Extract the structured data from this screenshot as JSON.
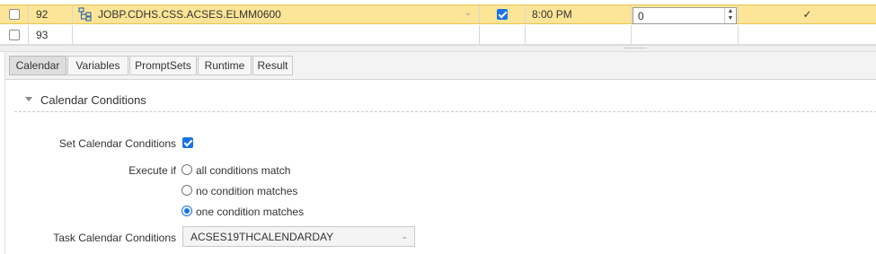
{
  "grid": {
    "rows": [
      {
        "number": "92",
        "job_name": "JOBP.CDHS.CSS.ACSES.ELMM0600",
        "job_icon": "workflow-icon",
        "active": true,
        "time": "8:00 PM",
        "value": "0",
        "status_mark": "✓"
      },
      {
        "number": "93",
        "job_name": "",
        "active": false,
        "time": "",
        "value": "",
        "status_mark": ""
      }
    ]
  },
  "tabs": [
    "Calendar",
    "Variables",
    "PromptSets",
    "Runtime",
    "Result"
  ],
  "active_tab": "Calendar",
  "calendar": {
    "section_title": "Calendar Conditions",
    "set_label": "Set Calendar Conditions",
    "set_checked": true,
    "execute_label": "Execute if",
    "options": [
      "all conditions match",
      "no condition matches",
      "one condition matches"
    ],
    "selected_option": "one condition matches",
    "task_label": "Task Calendar Conditions",
    "task_value": "ACSES19THCALENDARDAY"
  },
  "colors": {
    "selected_row": "#fde597",
    "accent": "#1a73e8"
  }
}
